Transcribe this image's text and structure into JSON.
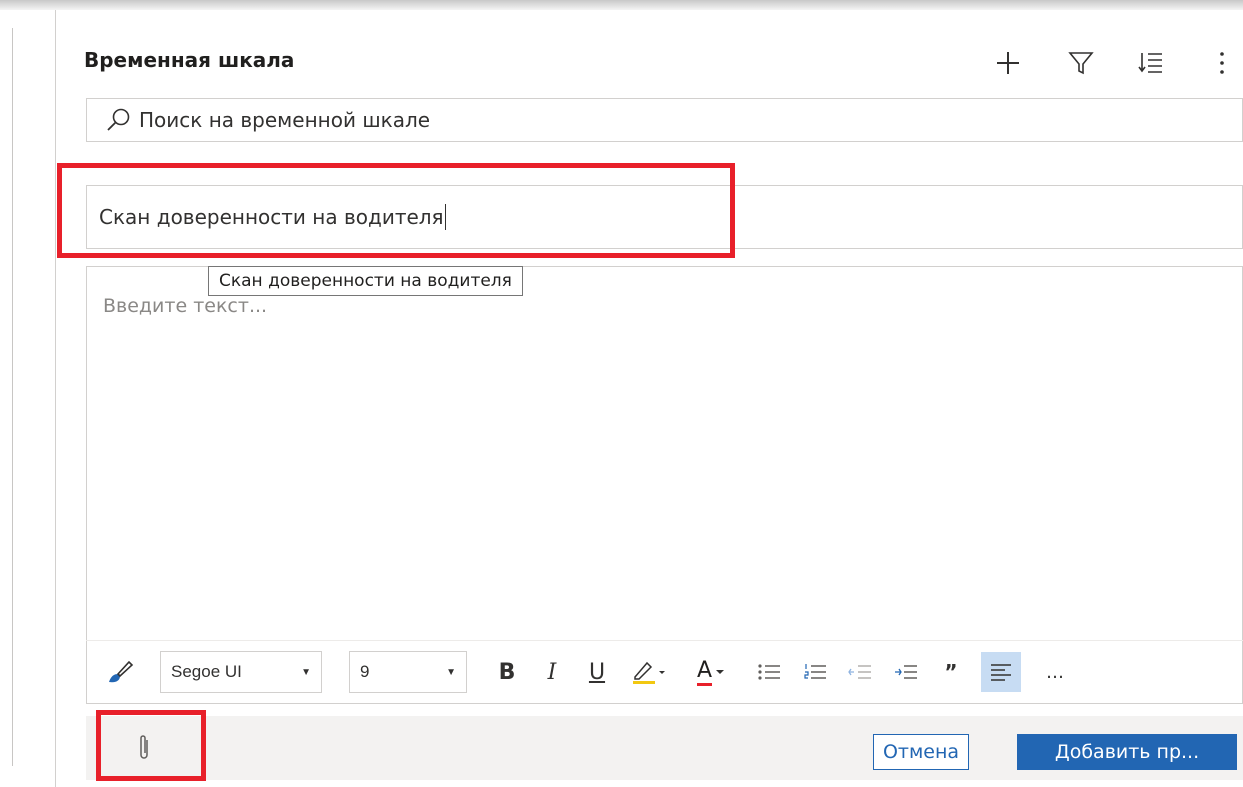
{
  "timeline": {
    "title": "Временная шкала",
    "header_icons": [
      "add-icon",
      "filter-icon",
      "sort-icon",
      "more-icon"
    ]
  },
  "search": {
    "placeholder": "Поиск на временной шкале"
  },
  "note": {
    "title_value": "Скан доверенности на водителя",
    "tooltip": "Скан доверенности на водителя",
    "body_placeholder": "Введите текст..."
  },
  "toolbar": {
    "font": "Segoe UI",
    "size": "9",
    "bold": "B",
    "italic": "I",
    "underline": "U",
    "font_color": "A",
    "quote": "”",
    "more": "…"
  },
  "footer": {
    "cancel_label": "Отмена",
    "add_label": "Добавить пр..."
  },
  "colors": {
    "accent": "#2266b3",
    "highlight_red": "#e8202a",
    "footer_bg": "#f3f2f1"
  }
}
